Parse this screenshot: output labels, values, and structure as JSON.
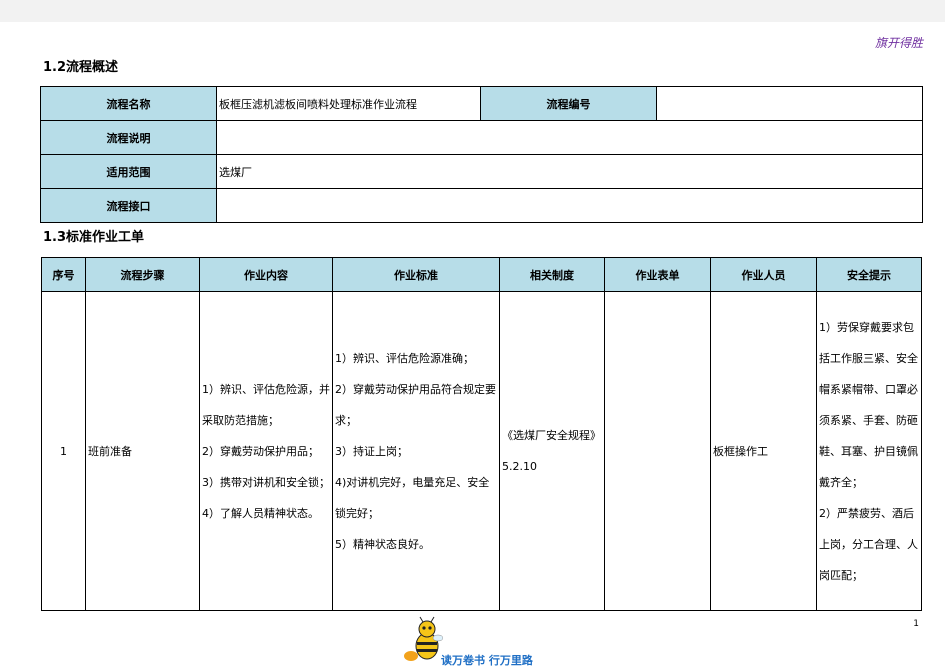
{
  "header": {
    "brand": "旗开得胜"
  },
  "overview": {
    "title": "1.2流程概述",
    "rows": [
      {
        "label": "流程名称",
        "value": "板框压滤机滤板间喷料处理标准作业流程",
        "label2": "流程编号",
        "value2": ""
      },
      {
        "label": "流程说明",
        "value": ""
      },
      {
        "label": "适用范围",
        "value": "选煤厂"
      },
      {
        "label": "流程接口",
        "value": ""
      }
    ]
  },
  "work": {
    "title": "1.3标准作业工单",
    "headers": [
      "序号",
      "流程步骤",
      "作业内容",
      "作业标准",
      "相关制度",
      "作业表单",
      "作业人员",
      "安全提示"
    ],
    "rows": [
      {
        "no": "1",
        "step": "班前准备",
        "content": [
          "1）辨识、评估危险源，并采取防范措施；",
          "2）穿戴劳动保护用品；",
          "3）携带对讲机和安全锁；",
          "4）了解人员精神状态。"
        ],
        "standard": [
          "1）辨识、评估危险源准确；",
          "2）穿戴劳动保护用品符合规定要求；",
          "3）持证上岗；",
          "4)对讲机完好，电量充足、安全锁完好；",
          "5）精神状态良好。"
        ],
        "system": "《选煤厂安全规程》5.2.10",
        "form": "",
        "worker": "板框操作工",
        "safety": [
          "1）劳保穿戴要求包括工作服三紧、安全帽系紧帽带、口罩必须系紧、手套、防砸鞋、耳塞、护目镜佩戴齐全；",
          "2）严禁疲劳、酒后上岗，分工合理、人岗匹配；"
        ]
      }
    ]
  },
  "footer": {
    "page_number": "1",
    "slogan": "读万卷书  行万里路"
  }
}
